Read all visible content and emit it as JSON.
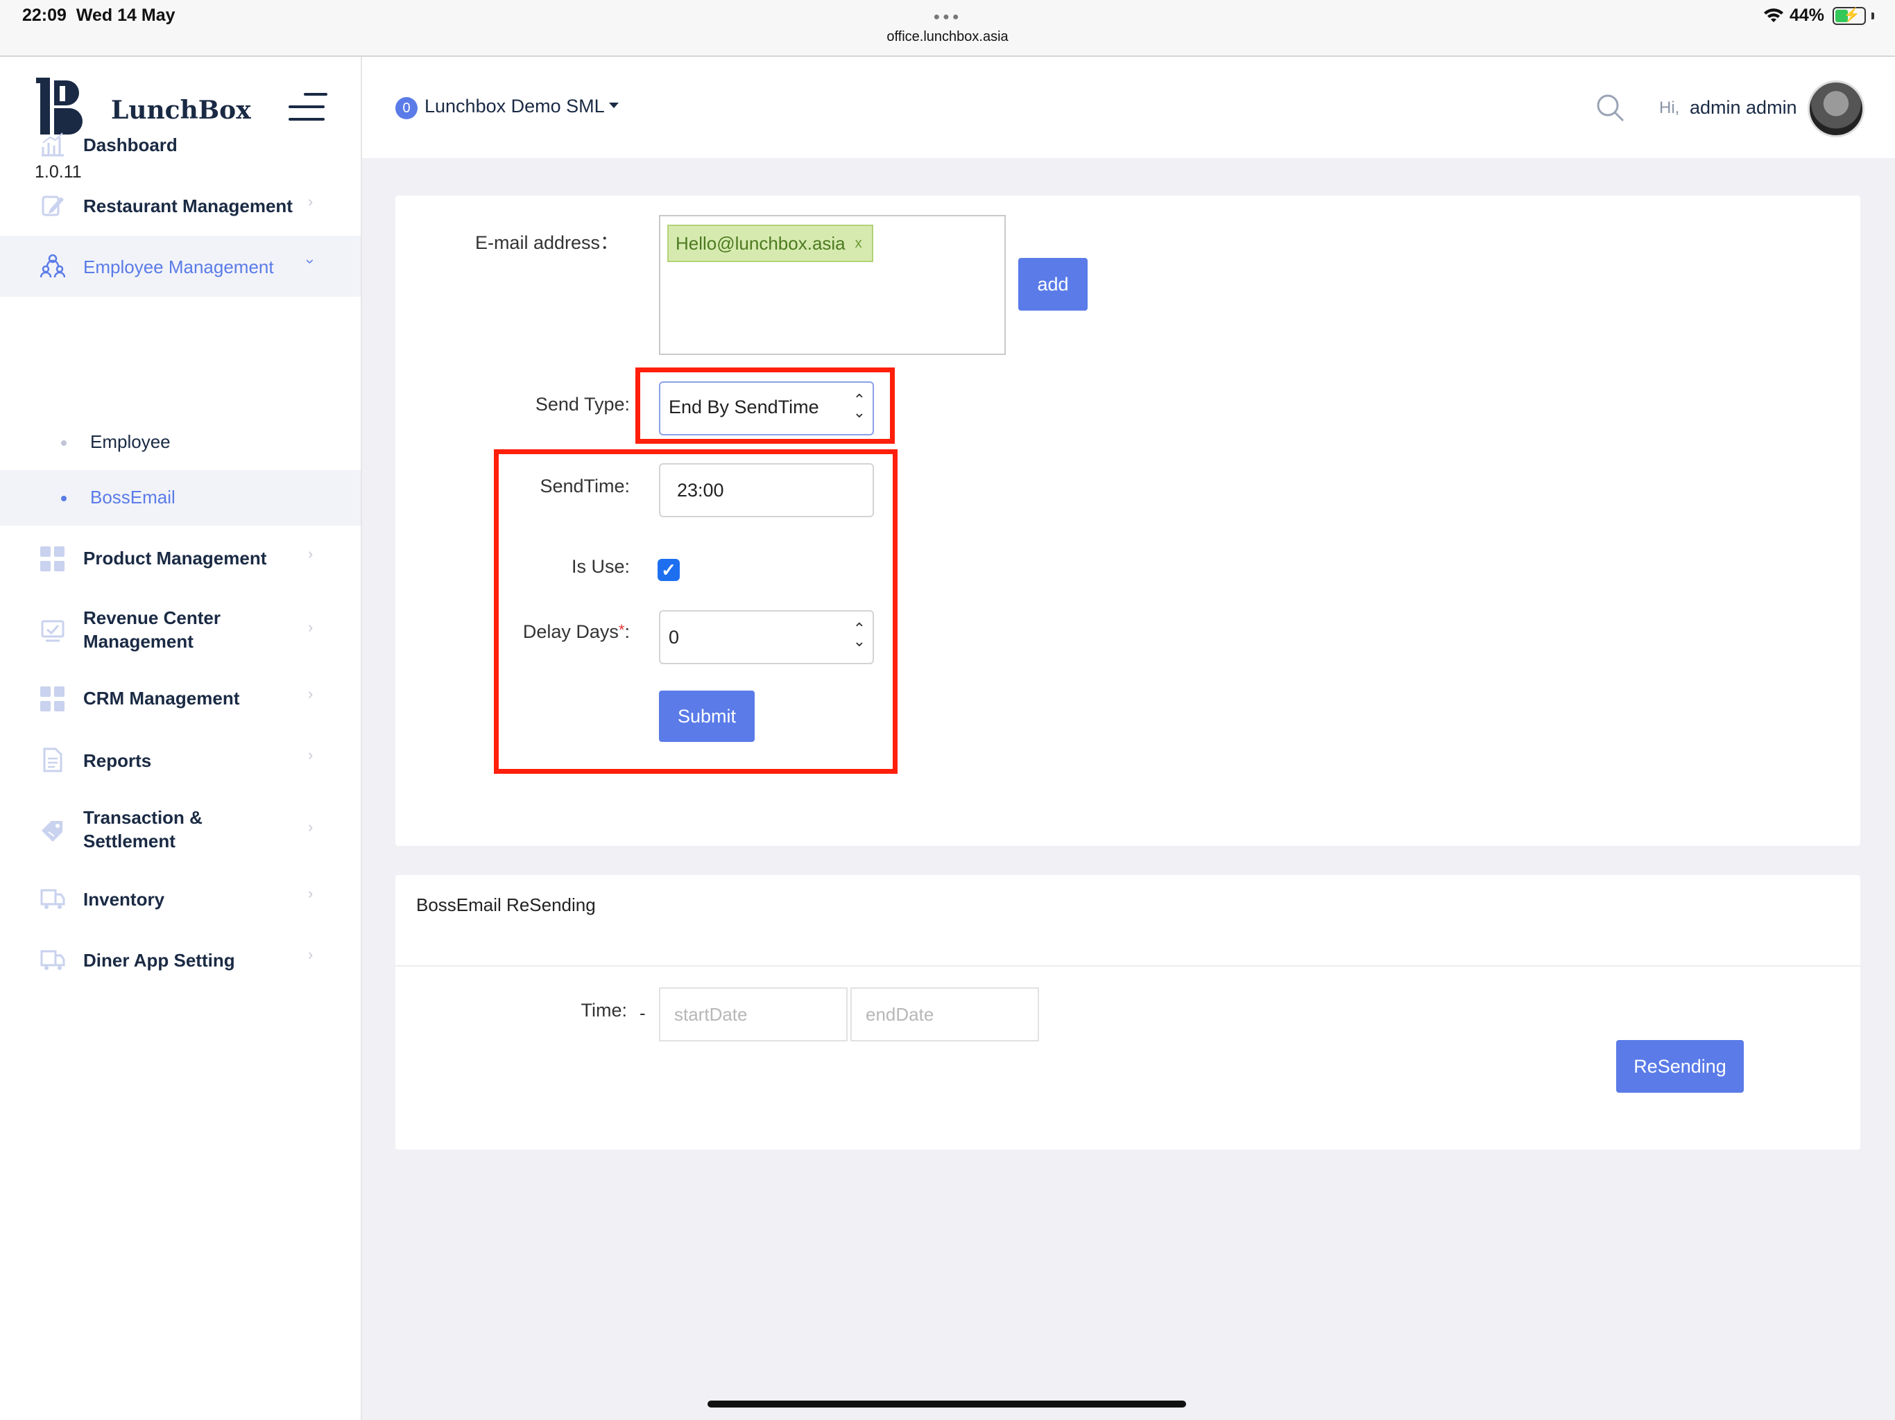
{
  "status_bar": {
    "time": "22:09",
    "date": "Wed 14 May",
    "url": "office.lunchbox.asia",
    "battery": "44%",
    "battery_level": 0.44
  },
  "sidebar": {
    "brand": "LunchBox",
    "version": "1.0.11",
    "items": [
      {
        "label": "Dashboard",
        "icon": "chart-icon"
      },
      {
        "label": "Restaurant Management",
        "icon": "edit-icon"
      },
      {
        "label": "Employee Management",
        "icon": "people-icon",
        "active": true,
        "expanded": true
      },
      {
        "label": "Product Management",
        "icon": "grid-icon"
      },
      {
        "label": "Revenue Center Management",
        "icon": "monitor-icon"
      },
      {
        "label": "CRM Management",
        "icon": "grid-icon"
      },
      {
        "label": "Reports",
        "icon": "document-icon"
      },
      {
        "label": "Transaction & Settlement",
        "icon": "tag-icon"
      },
      {
        "label": "Inventory",
        "icon": "truck-icon"
      },
      {
        "label": "Diner App Setting",
        "icon": "truck-icon"
      }
    ],
    "sub_items": [
      {
        "label": "Employee"
      },
      {
        "label": "BossEmail",
        "active": true
      }
    ]
  },
  "header": {
    "org_badge": "0",
    "org_name": "Lunchbox Demo SML",
    "greeting": "Hi,",
    "username": "admin admin"
  },
  "form": {
    "email_label": "E-mail address：",
    "email_tag": "Hello@lunchbox.asia",
    "email_tag_remove": "x",
    "add_button": "add",
    "send_type_label": "Send Type:",
    "send_type_value": "End By SendTime",
    "send_time_label": "SendTime:",
    "send_time_value": "23:00",
    "is_use_label": "Is Use:",
    "is_use_checked": true,
    "delay_days_label": "Delay Days",
    "delay_days_required": "*",
    "delay_days_colon": ":",
    "delay_days_value": "0",
    "submit_button": "Submit"
  },
  "resend": {
    "title": "BossEmail ReSending",
    "time_label": "Time:",
    "dash": "-",
    "start_placeholder": "startDate",
    "end_placeholder": "endDate",
    "button": "ReSending"
  },
  "colors": {
    "accent": "#5a7be8",
    "highlight": "#ff1f0a",
    "tag_bg": "#d6eab0",
    "checkbox": "#1e6ff0"
  }
}
